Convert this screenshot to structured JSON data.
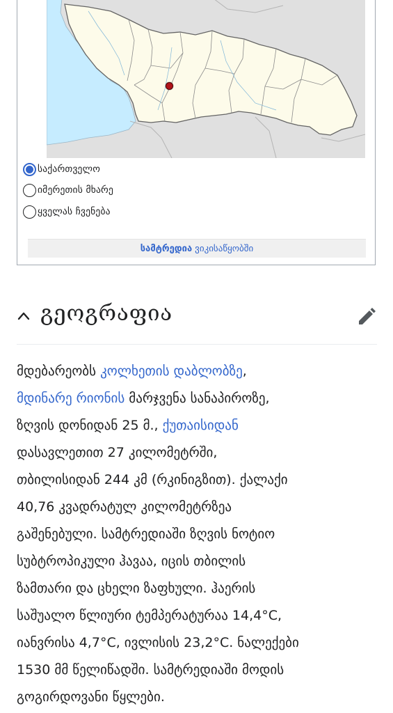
{
  "map": {
    "colors": {
      "sea": "#c6ecff",
      "land_neighbors": "#e0e0e0",
      "georgia": "#fdfbea",
      "border": "#646464",
      "marker": "#b0141a"
    }
  },
  "locator": {
    "options": [
      {
        "label": "საქართველო",
        "checked": true
      },
      {
        "label": "იმერეთის მხარე",
        "checked": false
      },
      {
        "label": "ყველას ჩვენება",
        "checked": false
      }
    ],
    "caption_bold": "სამტრედია",
    "caption_rest": "ვიკისაწყობში"
  },
  "section": {
    "title": "გეოგრაფია"
  },
  "body": {
    "l1_a": "მდებარეობს ",
    "l1_link": "კოლხეთის დაბლობზე",
    "l1_b": ",",
    "l2_link": "მდინარე რიონის",
    "l2_b": " მარჯვენა სანაპიროზე,",
    "l3_a": "ზღვის დონიდან 25 მ., ",
    "l3_link": "ქუთაისიდან",
    "l4": "დასავლეთით 27 კილომეტრში,",
    "l5": "თბილისიდან 244 კმ (რკინიგზით). ქალაქი",
    "l6": "40,76 კვადრატულ კილომეტრზეა",
    "l7": "გაშენებული. სამტრედიაში ზღვის ნოტიო",
    "l8": "სუბტროპიკული ჰავაა, იცის თბილის",
    "l9": "ზამთარი და ცხელი ზაფხული. ჰაერის",
    "l10": "საშუალო წლიური ტემპერატურაა 14,4°C,",
    "l11": "იანვრისა 4,7°C, ივლისის 23,2°C. ნალექები",
    "l12": "1530 მმ წელიწადში. სამტრედიაში მოდის",
    "l13": "გოგირდოვანი წყლები."
  }
}
